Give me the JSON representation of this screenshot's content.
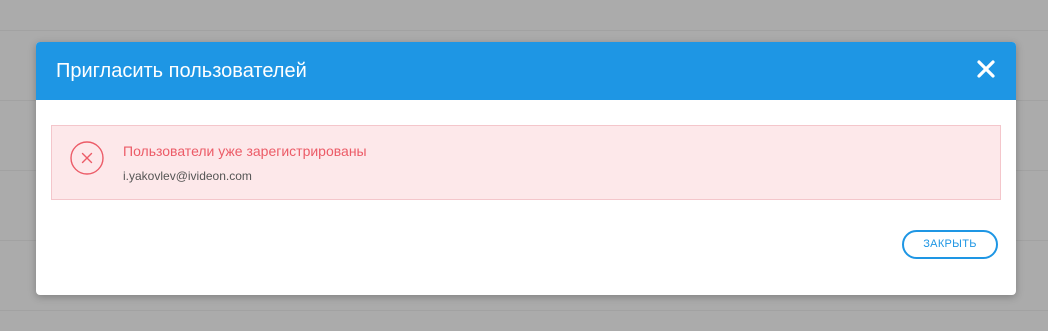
{
  "dialog": {
    "title": "Пригласить пользователей",
    "close_icon": "close-icon",
    "alert": {
      "icon": "error-circle-x-icon",
      "title": "Пользователи уже зарегистрированы",
      "email": "i.yakovlev@ivideon.com"
    },
    "close_button_label": "ЗАКРЫТЬ"
  },
  "colors": {
    "accent": "#1e96e4",
    "error_text": "#ec5b67",
    "error_background": "#fde8ea",
    "error_border": "#f4c6cb",
    "overlay": "#ababab"
  }
}
